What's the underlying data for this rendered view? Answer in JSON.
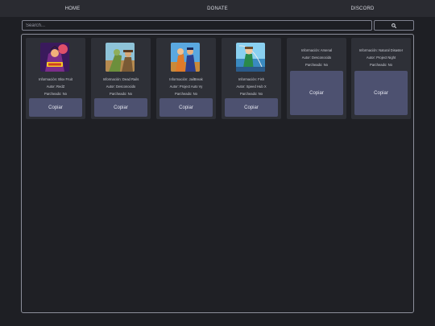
{
  "nav": {
    "home": "HOME",
    "donate": "DONATE",
    "discord": "DISCORD"
  },
  "search": {
    "placeholder": "Search...",
    "button_icon": "search-icon"
  },
  "cards": [
    {
      "info": "Información: Blox Fruit",
      "author": "Autor: RedZ",
      "patched": "Parcheado: No",
      "copy_label": "Copiar",
      "image": "blox-fruit-thumbnail"
    },
    {
      "info": "Información: Dead Rails",
      "author": "Autor: Desconocido",
      "patched": "Parcheado: No",
      "copy_label": "Copiar",
      "image": "dead-rails-thumbnail"
    },
    {
      "info": "Información: JailBreak",
      "author": "Autor: Project Auto Vy",
      "patched": "Parcheado: No",
      "copy_label": "Copiar",
      "image": "jailbreak-thumbnail"
    },
    {
      "info": "Información: Fish",
      "author": "Autor: Speed Hub X",
      "patched": "Parcheado: No",
      "copy_label": "Copiar",
      "image": "fish-thumbnail"
    },
    {
      "info": "Información: Arsenal",
      "author": "Autor: Desconocido",
      "patched": "Parcheado: No",
      "copy_label": "Copiar"
    },
    {
      "info": "Información: Natural Disaster",
      "author": "Autor: Project Night",
      "patched": "Parcheado: No",
      "copy_label": "Copiar"
    }
  ],
  "colors": {
    "background": "#1e1f24",
    "topbar": "#2a2b31",
    "card": "#2e3037",
    "button": "#4d5170"
  }
}
